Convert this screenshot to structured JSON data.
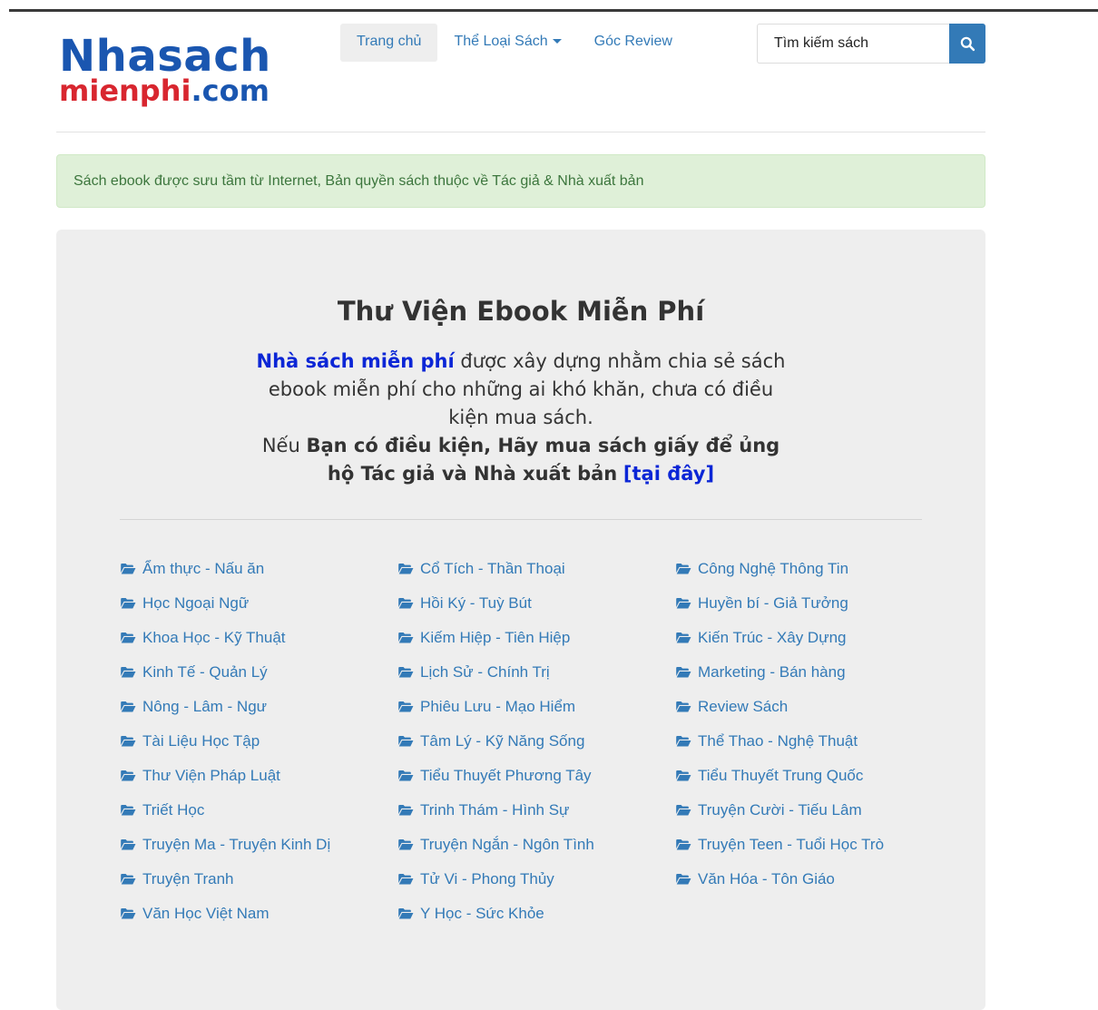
{
  "logo": {
    "line1": "Nhasach",
    "line2_part1": "mienphi",
    "line2_part2": ".com"
  },
  "nav": {
    "home": "Trang chủ",
    "categories": "Thể Loại Sách",
    "review": "Góc Review"
  },
  "search": {
    "placeholder": "Tìm kiếm sách"
  },
  "alert": {
    "text": "Sách ebook được sưu tầm từ Internet, Bản quyền sách thuộc về Tác giả & Nhà xuất bản"
  },
  "jumbotron": {
    "title": "Thư Viện Ebook Miễn Phí",
    "intro_highlight": "Nhà sách miễn phí",
    "intro_text": "được xây dựng nhằm chia sẻ sách ebook miễn phí cho những ai khó khăn, chưa có điều kiện mua sách.",
    "support_prefix": "Nếu",
    "support_bold": "Bạn có điều kiện, Hãy mua sách giấy để ủng hộ Tác giả và Nhà xuất bản",
    "support_link": "[tại đây]"
  },
  "colors": {
    "link": "#337ab7",
    "highlight": "#0b26d6",
    "alert_bg": "#dff0d8",
    "jumbotron_bg": "#eeeeee",
    "logo_blue": "#1a56b0",
    "logo_red": "#d8262f"
  },
  "category_icon": "folder-open-icon",
  "categories": [
    [
      "Ẩm thực - Nấu ăn",
      "Cổ Tích - Thần Thoại",
      "Công Nghệ Thông Tin"
    ],
    [
      "Học Ngoại Ngữ",
      "Hồi Ký - Tuỳ Bút",
      "Huyền bí - Giả Tưởng"
    ],
    [
      "Khoa Học - Kỹ Thuật",
      "Kiếm Hiệp - Tiên Hiệp",
      "Kiến Trúc - Xây Dựng"
    ],
    [
      "Kinh Tế - Quản Lý",
      "Lịch Sử - Chính Trị",
      "Marketing - Bán hàng"
    ],
    [
      "Nông - Lâm - Ngư",
      "Phiêu Lưu - Mạo Hiểm",
      "Review Sách"
    ],
    [
      "Tài Liệu Học Tập",
      "Tâm Lý - Kỹ Năng Sống",
      "Thể Thao - Nghệ Thuật"
    ],
    [
      "Thư Viện Pháp Luật",
      "Tiểu Thuyết Phương Tây",
      "Tiểu Thuyết Trung Quốc"
    ],
    [
      "Triết Học",
      "Trinh Thám - Hình Sự",
      "Truyện Cười - Tiếu Lâm"
    ],
    [
      "Truyện Ma - Truyện Kinh Dị",
      "Truyện Ngắn - Ngôn Tình",
      "Truyện Teen - Tuổi Học Trò"
    ],
    [
      "Truyện Tranh",
      "Tử Vi - Phong Thủy",
      "Văn Hóa - Tôn Giáo"
    ],
    [
      "Văn Học Việt Nam",
      "Y Học - Sức Khỏe"
    ]
  ]
}
